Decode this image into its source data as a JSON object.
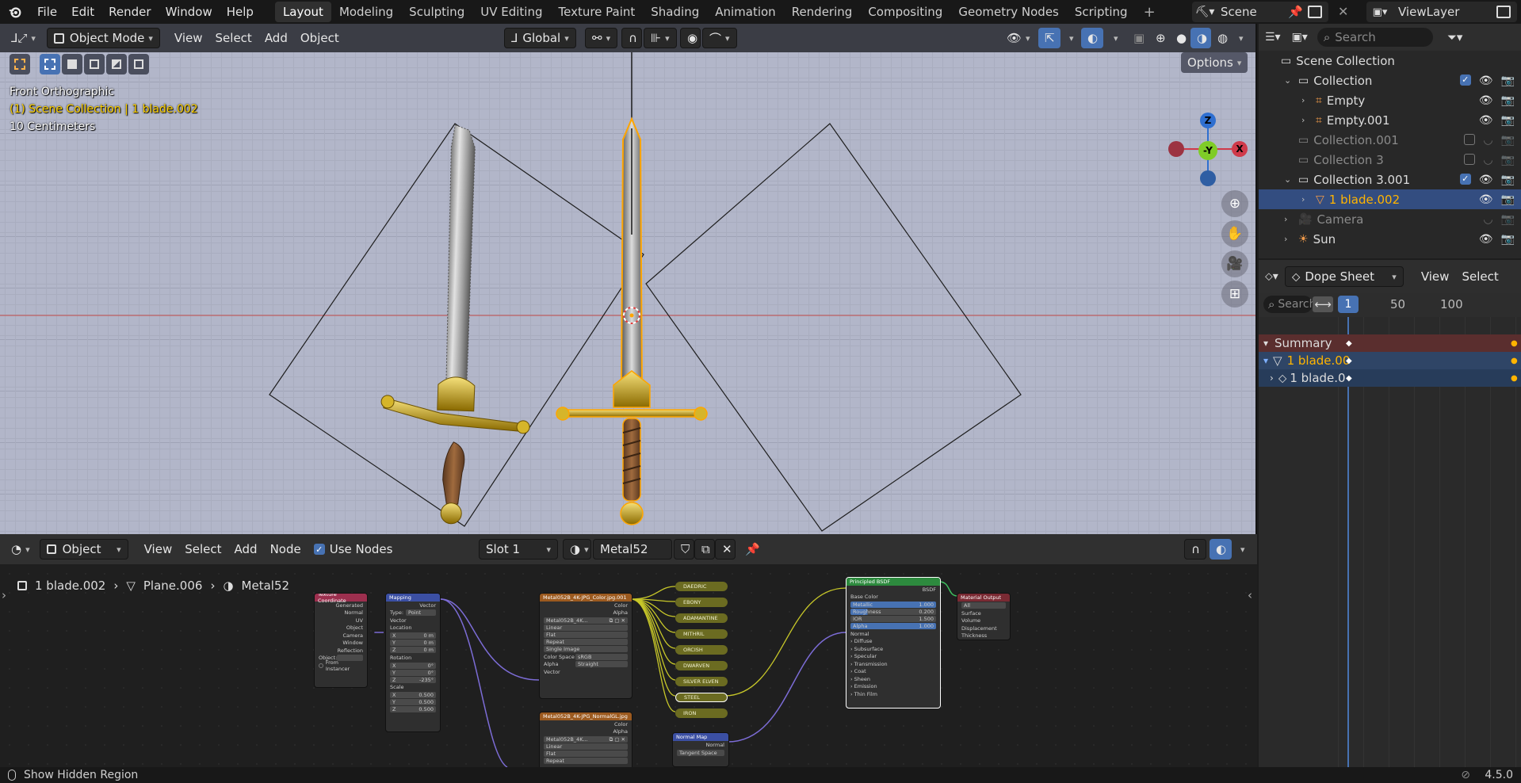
{
  "topbar": {
    "menus": [
      "File",
      "Edit",
      "Render",
      "Window",
      "Help"
    ],
    "workspaces": [
      "Layout",
      "Modeling",
      "Sculpting",
      "UV Editing",
      "Texture Paint",
      "Shading",
      "Animation",
      "Rendering",
      "Compositing",
      "Geometry Nodes",
      "Scripting"
    ],
    "add_tab": "+",
    "scene": "Scene",
    "view_layer": "ViewLayer"
  },
  "viewport": {
    "mode": "Object Mode",
    "menus": [
      "View",
      "Select",
      "Add",
      "Object"
    ],
    "transform_orientation": "Global",
    "options_label": "Options",
    "overlay_view_name": "Front Orthographic",
    "overlay_collection": "(1) Scene Collection | 1 blade.002",
    "overlay_scale": "10 Centimeters",
    "gizmo": {
      "z": "Z",
      "y": "-Y",
      "x": "X"
    }
  },
  "node_editor": {
    "editor_type": "Object",
    "menus": [
      "View",
      "Select",
      "Add",
      "Node"
    ],
    "use_nodes_label": "Use Nodes",
    "use_nodes_checked": true,
    "slot": "Slot 1",
    "material": "Metal52",
    "breadcrumb": [
      "1 blade.002",
      "Plane.006",
      "Metal52"
    ],
    "nodes": {
      "texcoord": {
        "title": "Texture Coordinate",
        "outputs": [
          "Generated",
          "Normal",
          "UV",
          "Object",
          "Camera",
          "Window",
          "Reflection"
        ],
        "object_label": "Object:",
        "from_instancer": "From Instancer"
      },
      "mapping": {
        "title": "Mapping",
        "output": "Vector",
        "type_label": "Type:",
        "type_value": "Point",
        "vector": "Vector",
        "location": "Location",
        "loc": [
          [
            "X",
            "0 m"
          ],
          [
            "Y",
            "0 m"
          ],
          [
            "Z",
            "0 m"
          ]
        ],
        "rotation": "Rotation",
        "rot": [
          [
            "X",
            "0°"
          ],
          [
            "Y",
            "0°"
          ],
          [
            "Z",
            "-235°"
          ]
        ],
        "scale": "Scale",
        "scl": [
          [
            "X",
            "0.500"
          ],
          [
            "Y",
            "0.500"
          ],
          [
            "Z",
            "0.500"
          ]
        ]
      },
      "image_color": {
        "title": "Metal052B_4K-JPG_Color.jpg.001",
        "outputs": [
          "Color",
          "Alpha"
        ],
        "image_name": "Metal052B_4K...",
        "fields": [
          "Linear",
          "Flat",
          "Repeat",
          "Single Image"
        ],
        "colorspace_label": "Color Space",
        "colorspace": "sRGB",
        "alpha_label": "Alpha",
        "alpha": "Straight",
        "input": "Vector"
      },
      "image_normal": {
        "title": "Metal052B_4K-JPG_NormalGL.jpg",
        "outputs": [
          "Color",
          "Alpha"
        ],
        "image_name": "Metal052B_4K...",
        "fields": [
          "Linear",
          "Flat",
          "Repeat"
        ]
      },
      "reroutes": [
        "DAEDRIC",
        "EBONY",
        "ADAMANTINE",
        "MITHRIL",
        "ORCISH",
        "DWARVEN",
        "SILVER ELVEN",
        "STEEL",
        "IRON"
      ],
      "bsdf": {
        "title": "Principled BSDF",
        "output": "BSDF",
        "base_color": "Base Color",
        "fields": [
          [
            "Metallic",
            "1.000"
          ],
          [
            "Roughness",
            "0.200"
          ],
          [
            "IOR",
            "1.500"
          ],
          [
            "Alpha",
            "1.000"
          ]
        ],
        "normal": "Normal",
        "panels": [
          "Diffuse",
          "Subsurface",
          "Specular",
          "Transmission",
          "Coat",
          "Sheen",
          "Emission",
          "Thin Film"
        ]
      },
      "output": {
        "title": "Material Output",
        "target": "All",
        "inputs": [
          "Surface",
          "Volume",
          "Displacement",
          "Thickness"
        ]
      },
      "normal_map": {
        "title": "Normal Map",
        "output": "Normal",
        "space": "Tangent Space"
      }
    }
  },
  "outliner": {
    "search_placeholder": "Search",
    "rows": [
      {
        "label": "Scene Collection",
        "indent": 0,
        "type": "scene"
      },
      {
        "label": "Collection",
        "indent": 1,
        "type": "collection",
        "expanded": true,
        "checked": true
      },
      {
        "label": "Empty",
        "indent": 2,
        "type": "empty"
      },
      {
        "label": "Empty.001",
        "indent": 2,
        "type": "empty"
      },
      {
        "label": "Collection.001",
        "indent": 1,
        "type": "collection",
        "dim": true,
        "checked": false
      },
      {
        "label": "Collection 3",
        "indent": 1,
        "type": "collection",
        "dim": true,
        "checked": false
      },
      {
        "label": "Collection 3.001",
        "indent": 1,
        "type": "collection",
        "expanded": true,
        "checked": true
      },
      {
        "label": "1 blade.002",
        "indent": 2,
        "type": "mesh",
        "selected": true
      },
      {
        "label": "Camera",
        "indent": 1,
        "type": "camera",
        "dim": true
      },
      {
        "label": "Sun",
        "indent": 1,
        "type": "light"
      }
    ]
  },
  "dopesheet": {
    "mode": "Dope Sheet",
    "menus": [
      "View",
      "Select"
    ],
    "search_placeholder": "Search",
    "current_frame": "1",
    "ruler": [
      "50",
      "100"
    ],
    "rows": [
      {
        "label": "Summary",
        "type": "summary"
      },
      {
        "label": "1 blade.00",
        "type": "object"
      },
      {
        "label": "1 blade.0",
        "type": "action"
      }
    ]
  },
  "statusbar": {
    "hint": "Show Hidden Region",
    "version": "4.5.0"
  },
  "colors": {
    "accent": "#4772b3",
    "selection": "#334d80",
    "viewport_bg": "#b2b6c9",
    "active_object": "#ffa500"
  }
}
